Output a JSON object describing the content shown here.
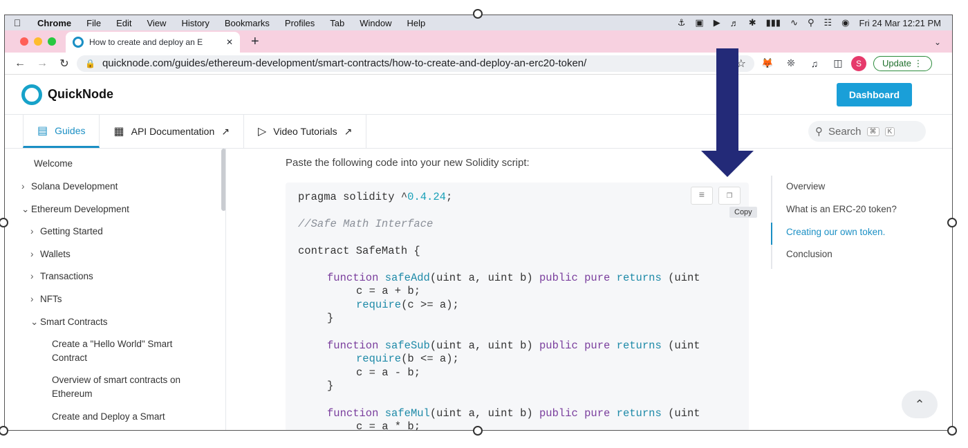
{
  "menubar": {
    "items": [
      "Chrome",
      "File",
      "Edit",
      "View",
      "History",
      "Bookmarks",
      "Profiles",
      "Tab",
      "Window",
      "Help"
    ],
    "clock": "Fri 24 Mar  12:21 PM"
  },
  "browser": {
    "tab_title": "How to create and deploy an E",
    "url": "quicknode.com/guides/ethereum-development/smart-contracts/how-to-create-and-deploy-an-erc20-token/",
    "profile_initial": "S",
    "update_label": "Update"
  },
  "site": {
    "brand": "QuickNode",
    "dashboard_label": "Dashboard",
    "nav": [
      {
        "label": "Guides"
      },
      {
        "label": "API Documentation"
      },
      {
        "label": "Video Tutorials"
      }
    ],
    "search_placeholder": "Search",
    "search_key1": "⌘",
    "search_key2": "K"
  },
  "sidebar": {
    "items": [
      {
        "label": "Welcome"
      },
      {
        "label": "Solana Development"
      },
      {
        "label": "Ethereum Development"
      },
      {
        "label": "Getting Started"
      },
      {
        "label": "Wallets"
      },
      {
        "label": "Transactions"
      },
      {
        "label": "NFTs"
      },
      {
        "label": "Smart Contracts"
      },
      {
        "label": "Create a \"Hello World\" Smart"
      },
      {
        "label": "Contract"
      },
      {
        "label": "Overview of smart contracts on"
      },
      {
        "label": "Ethereum"
      },
      {
        "label": "Create and Deploy a Smart"
      }
    ]
  },
  "main": {
    "intro": "Paste the following code into your new Solidity script:",
    "copy_tooltip": "Copy",
    "code": {
      "pragma": "pragma solidity ^",
      "version": "0.4.24",
      "semicolon": ";",
      "comment": "//Safe Math Interface",
      "contract": "contract SafeMath {",
      "function": "function",
      "safe_add": "safeAdd",
      "safe_sub": "safeSub",
      "safe_mul": "safeMul",
      "params": "(uint a, uint b)",
      "public": "public",
      "pure": "pure",
      "returns": "returns",
      "uint": "(uint",
      "add_body": "c = a + b;",
      "require": "require",
      "add_require": "(c >= a);",
      "close_brace": "}",
      "sub_require": "(b <= a);",
      "sub_body": "c = a - b;",
      "mul_body": "c = a * b;"
    }
  },
  "toc": {
    "items": [
      {
        "label": "Overview"
      },
      {
        "label": "What is an ERC-20 token?"
      },
      {
        "label": "Creating our own token."
      },
      {
        "label": "Conclusion"
      }
    ]
  }
}
